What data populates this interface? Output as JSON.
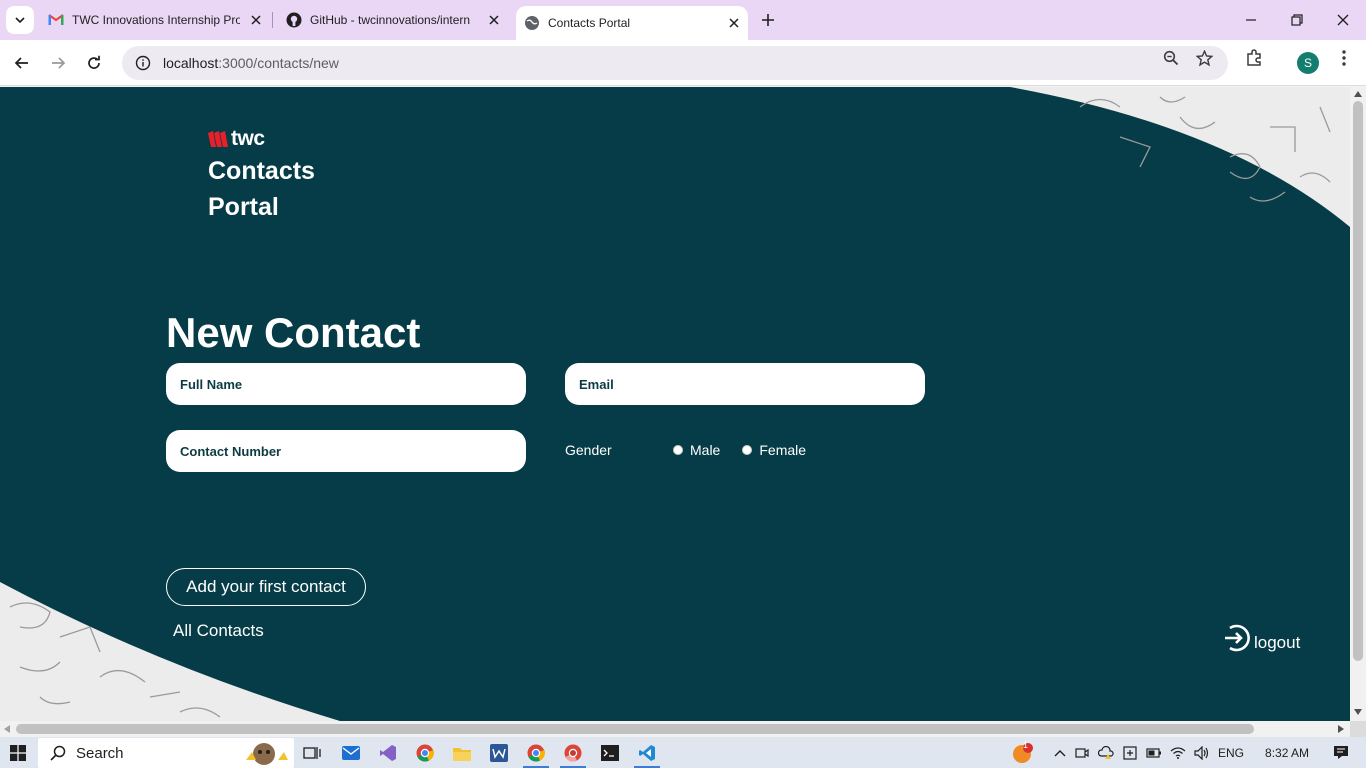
{
  "browser": {
    "tabs": [
      {
        "title": "TWC Innovations Internship Pro",
        "icon": "gmail-icon"
      },
      {
        "title": "GitHub - twcinnovations/intern",
        "icon": "github-icon"
      },
      {
        "title": "Contacts Portal",
        "icon": "globe-icon",
        "active": true
      }
    ],
    "url_host": "localhost",
    "url_path": ":3000/contacts/new",
    "profile_initial": "S"
  },
  "page": {
    "brand": {
      "logo_text": "twc",
      "app_name": "Contacts Portal"
    },
    "title": "New Contact",
    "form": {
      "full_name_placeholder": "Full Name",
      "email_placeholder": "Email",
      "contact_number_placeholder": "Contact Number",
      "gender_label": "Gender",
      "gender_options": [
        "Male",
        "Female"
      ]
    },
    "add_button": "Add your first contact",
    "all_contacts": "All Contacts",
    "logout": "logout",
    "colors": {
      "background": "#063c47",
      "accent": "#e8202a",
      "text": "#ffffff"
    }
  },
  "taskbar": {
    "search_placeholder": "Search",
    "language": "ENG",
    "time": "8:32 AM",
    "notification_count": "1"
  }
}
